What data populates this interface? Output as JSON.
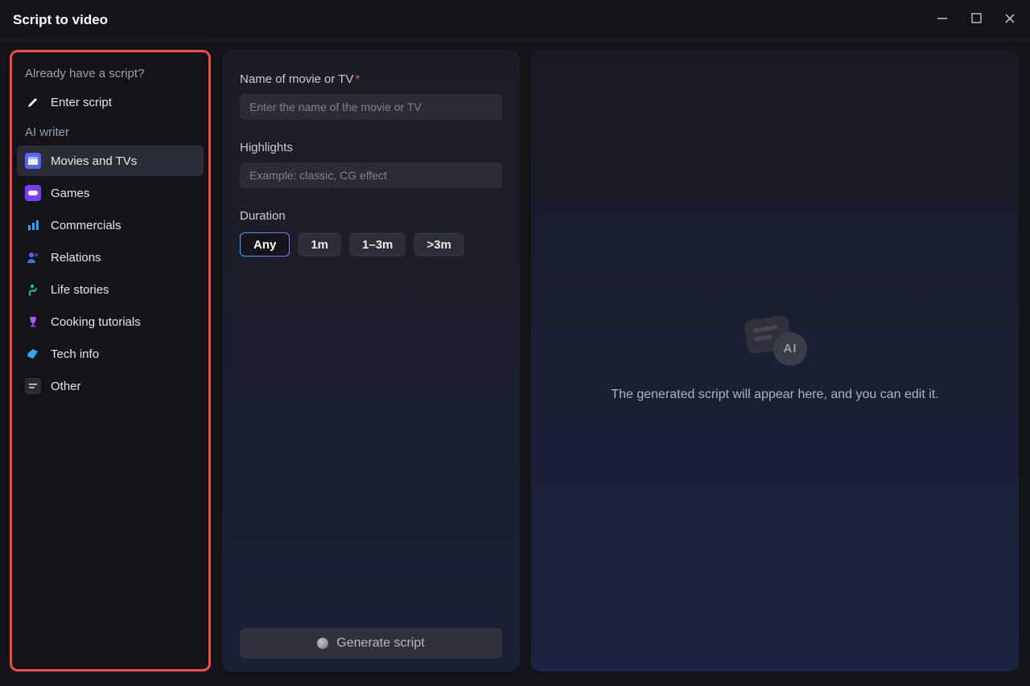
{
  "window": {
    "title": "Script to video"
  },
  "sidebar": {
    "section_have_script": "Already have a script?",
    "enter_script": "Enter script",
    "section_ai_writer": "AI writer",
    "items": {
      "movies": "Movies and TVs",
      "games": "Games",
      "commercials": "Commercials",
      "relations": "Relations",
      "life": "Life stories",
      "cooking": "Cooking tutorials",
      "tech": "Tech info",
      "other": "Other"
    }
  },
  "form": {
    "name_label": "Name of movie or TV",
    "name_placeholder": "Enter the name of the movie or TV",
    "highlights_label": "Highlights",
    "highlights_placeholder": "Example: classic, CG effect",
    "duration_label": "Duration",
    "duration_options": {
      "any": "Any",
      "m1": "1m",
      "m1_3": "1–3m",
      "m3": ">3m"
    },
    "generate_label": "Generate script"
  },
  "output": {
    "ai_badge": "AI",
    "placeholder_text": "The generated script will appear here, and you can edit it."
  }
}
